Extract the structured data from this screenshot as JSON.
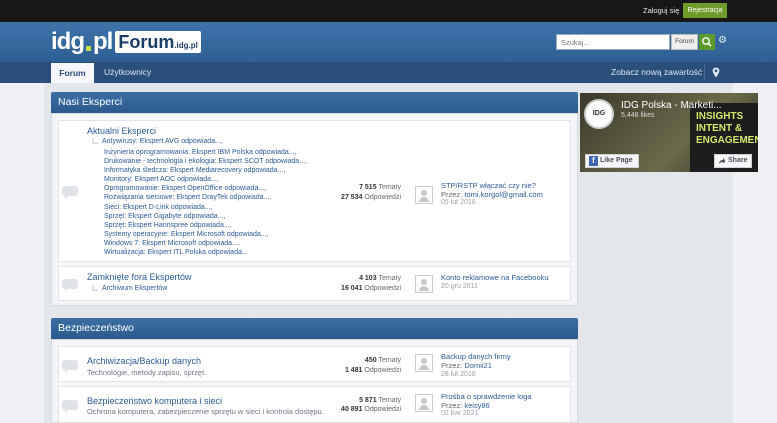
{
  "topbar": {
    "login": "Zaloguj się",
    "register": "Rejestracja"
  },
  "header": {
    "logo_idg": "idg",
    "logo_pl": "pl",
    "logo_forum": "Forum",
    "logo_domain": ".idg.pl",
    "search_placeholder": "Szukaj...",
    "search_scope": "Forum"
  },
  "nav": {
    "tab_forum": "Forum",
    "tab_users": "Użytkownicy",
    "new_content": "Zobacz nową zawartość"
  },
  "categories": [
    {
      "title": "Nasi Eksperci",
      "forums": [
        {
          "title": "Aktualni Eksperci",
          "subforum_root": "Antywirusy: Ekspert AVG odpowiada...,",
          "subforums": [
            "Inżynieria oprogramowania: Ekspert IBM Polska odpowiada...,",
            "Drukowanie - technologia i ekologia: Ekspert SCOT odpowiada...,",
            "Informatyka śledcza: Ekspert Mediarecovery odpowiada...,",
            "Monitory: Ekspert AOC odpowiada...,",
            "Oprogramowanie: Ekspert OpenOffice odpowiada...,",
            "Rozwiązania sieciowe: Ekspert DrayTek odpowiada...,",
            "Sieci: Ekspert D-Link odpowiada...,",
            "Sprzęt: Ekspert Gigabyte odpowiada...,",
            "Sprzęt: Ekspert Hannspree odpowiada...,",
            "Systemy operacyjne: Ekspert Microsoft odpowiada...,",
            "Windows 7: Ekspert Microsoft odpowiada...,",
            "Wirtualizacja: Ekspert ITL Polska odpowiada..."
          ],
          "topics_value": "7 515",
          "topics_label": "Tematy",
          "replies_value": "27 534",
          "replies_label": "Odpowiedzi",
          "last_title": "STP/RSTP włączać czy nie?",
          "last_by_label": "Przez:",
          "last_by": "tomi.korgol@gmail.com",
          "last_date": "05 lut 2018"
        },
        {
          "title": "Zamknięte fora Ekspertów",
          "subforum_root": "Archiwum Ekspertów",
          "topics_value": "4 103",
          "topics_label": "Tematy",
          "replies_value": "16 041",
          "replies_label": "Odpowiedzi",
          "last_title": "Konto reklamowe na Facebooku",
          "last_date": "20 gru 2011"
        }
      ]
    },
    {
      "title": "Bezpieczeństwo",
      "forums": [
        {
          "title": "Archiwizacja/Backup danych",
          "desc": "Technologie, metody zapisu, sprzęt.",
          "topics_value": "450",
          "topics_label": "Tematy",
          "replies_value": "1 481",
          "replies_label": "Odpowiedzi",
          "last_title": "Backup danych firmy",
          "last_by_label": "Przez:",
          "last_by": "Domii21",
          "last_date": "28 lut 2018"
        },
        {
          "title": "Bezpieczeństwo komputera i sieci",
          "desc": "Ochrona komputera, zabezpieczenie sprzętu w sieci i kontrola dostępu.",
          "topics_value": "5 871",
          "topics_label": "Tematy",
          "replies_value": "40 891",
          "replies_label": "Odpowiedzi",
          "last_title": "Prośba o sprawdzenie loga",
          "last_by_label": "Przez:",
          "last_by": "keisy86",
          "last_date": "02 kwi 2021"
        }
      ]
    }
  ],
  "facebook": {
    "page_name": "IDG Polska - Marketi...",
    "likes": "5,448 likes",
    "like_button": "Like Page",
    "share_button": "Share",
    "logo_text": "IDG",
    "banner_text": "INSIGHTS INTENT & ENGAGEMEN"
  },
  "colors": {
    "accent": "#2e5f93",
    "register": "#6e9b2a",
    "link": "#2a5b96"
  }
}
